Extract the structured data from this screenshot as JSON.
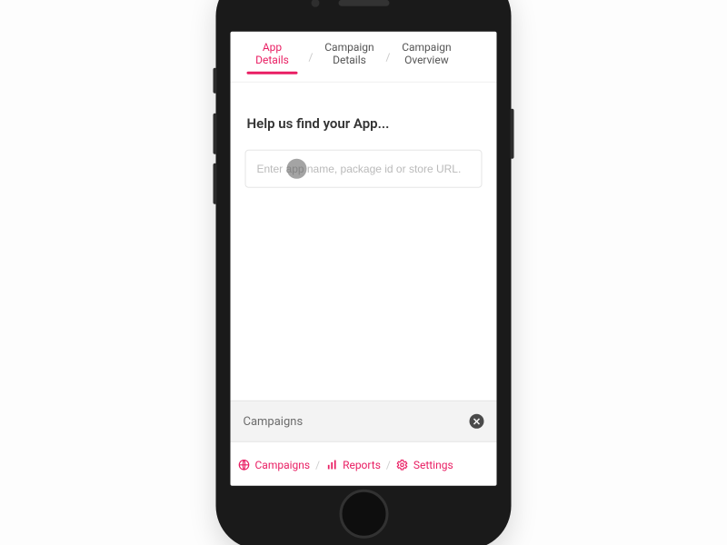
{
  "tabs": {
    "app_details": "App\nDetails",
    "campaign_details": "Campaign\nDetails",
    "campaign_overview": "Campaign\nOverview"
  },
  "heading": "Help us find your App...",
  "search": {
    "placeholder": "Enter app name, package id or store URL.",
    "value": ""
  },
  "footer": {
    "label": "Campaigns"
  },
  "nav": {
    "campaigns": "Campaigns",
    "reports": "Reports",
    "settings": "Settings"
  },
  "colors": {
    "accent": "#e91e63"
  }
}
